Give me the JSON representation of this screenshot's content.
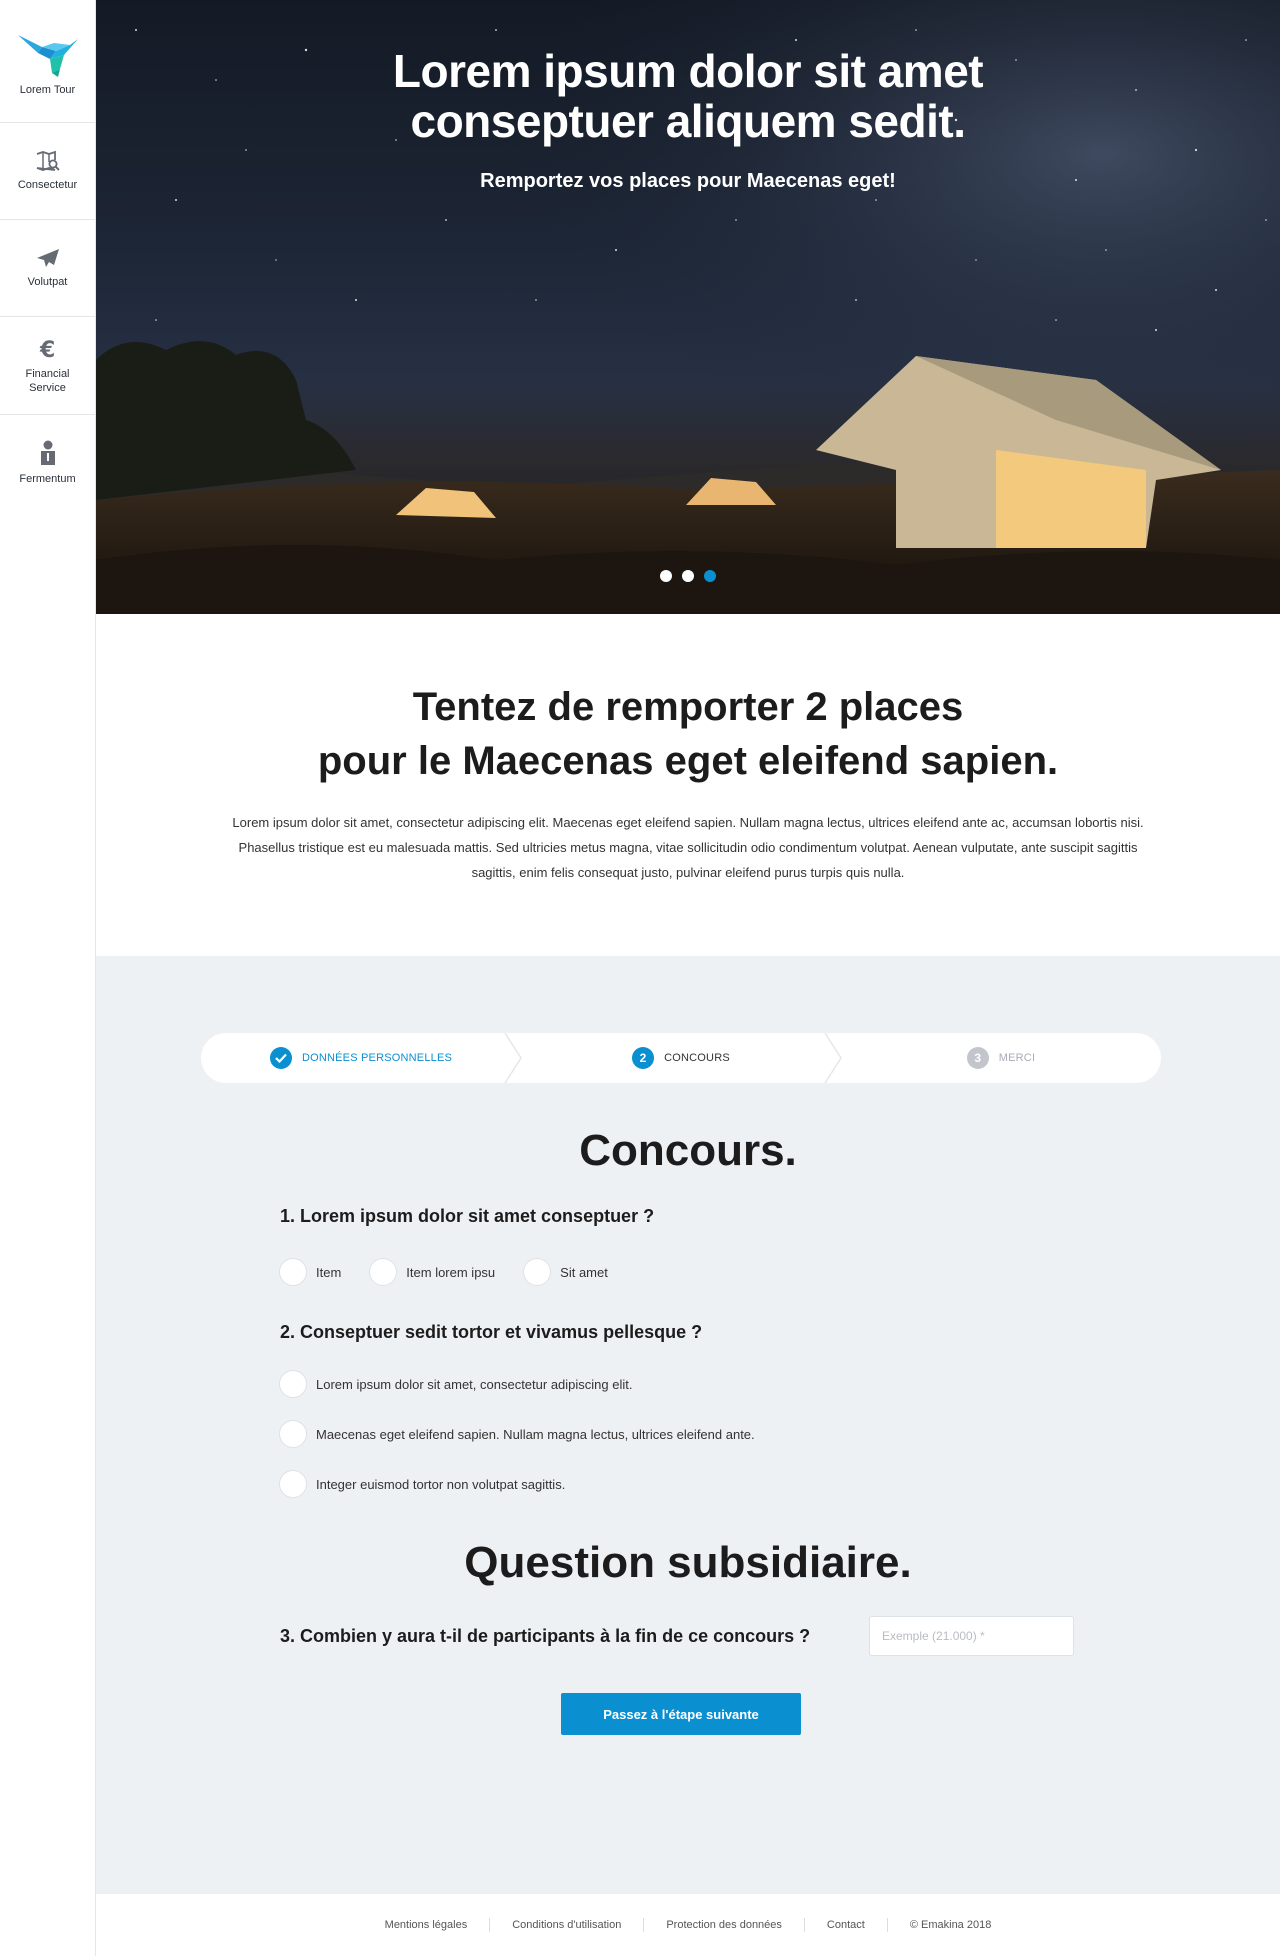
{
  "sidebar": {
    "items": [
      {
        "label": "Lorem Tour",
        "icon": "hummingbird-logo-icon"
      },
      {
        "label": "Consectetur",
        "icon": "map-search-icon"
      },
      {
        "label": "Volutpat",
        "icon": "airplane-icon"
      },
      {
        "label": "Financial Service",
        "icon": "euro-icon"
      },
      {
        "label": "Fermentum",
        "icon": "person-icon"
      }
    ]
  },
  "hero": {
    "title_line1": "Lorem ipsum dolor sit amet",
    "title_line2": "conseptuer aliquem sedit.",
    "subtitle": "Remportez vos places pour Maecenas eget!",
    "slides": 3,
    "active_slide": 3
  },
  "intro": {
    "title_line1": "Tentez de remporter 2 places",
    "title_line2": "pour le Maecenas eget eleifend sapien.",
    "paragraph": "Lorem ipsum dolor sit amet, consectetur adipiscing elit. Maecenas eget eleifend sapien. Nullam magna lectus, ultrices eleifend ante ac, accumsan lobortis nisi. Phasellus tristique est eu malesuada mattis. Sed ultricies metus magna, vitae sollicitudin odio condimentum volutpat. Aenean vulputate, ante suscipit sagittis sagittis, enim felis consequat justo, pulvinar eleifend purus turpis quis nulla."
  },
  "stepper": {
    "steps": [
      {
        "number": "",
        "label": "DONNÉES PERSONNELLES",
        "state": "done"
      },
      {
        "number": "2",
        "label": "CONCOURS",
        "state": "active"
      },
      {
        "number": "3",
        "label": "MERCI",
        "state": "upcoming"
      }
    ]
  },
  "form": {
    "title": "Concours.",
    "q1": {
      "label": "1. Lorem ipsum dolor sit amet conseptuer ?",
      "options": [
        "Item",
        "Item lorem ipsu",
        "Sit amet"
      ]
    },
    "q2": {
      "label": "2. Conseptuer sedit tortor et vivamus pellesque ?",
      "options": [
        "Lorem ipsum dolor sit amet, consectetur adipiscing elit.",
        "Maecenas eget eleifend sapien. Nullam magna lectus, ultrices eleifend ante.",
        "Integer euismod tortor non volutpat sagittis."
      ]
    },
    "subsidiary_title": "Question subsidiaire.",
    "q3": {
      "label": "3. Combien y aura t-il de participants à la fin de ce concours ?",
      "placeholder": "Exemple (21.000) *",
      "value": ""
    },
    "next_label": "Passez à l'étape suivante"
  },
  "footer": {
    "links": [
      "Mentions légales",
      "Conditions d'utilisation",
      "Protection des données",
      "Contact"
    ],
    "copyright": "© Emakina 2018"
  },
  "colors": {
    "accent": "#0a8fd1",
    "form_bg": "#eef1f4",
    "text_dark": "#1c1c1c"
  }
}
